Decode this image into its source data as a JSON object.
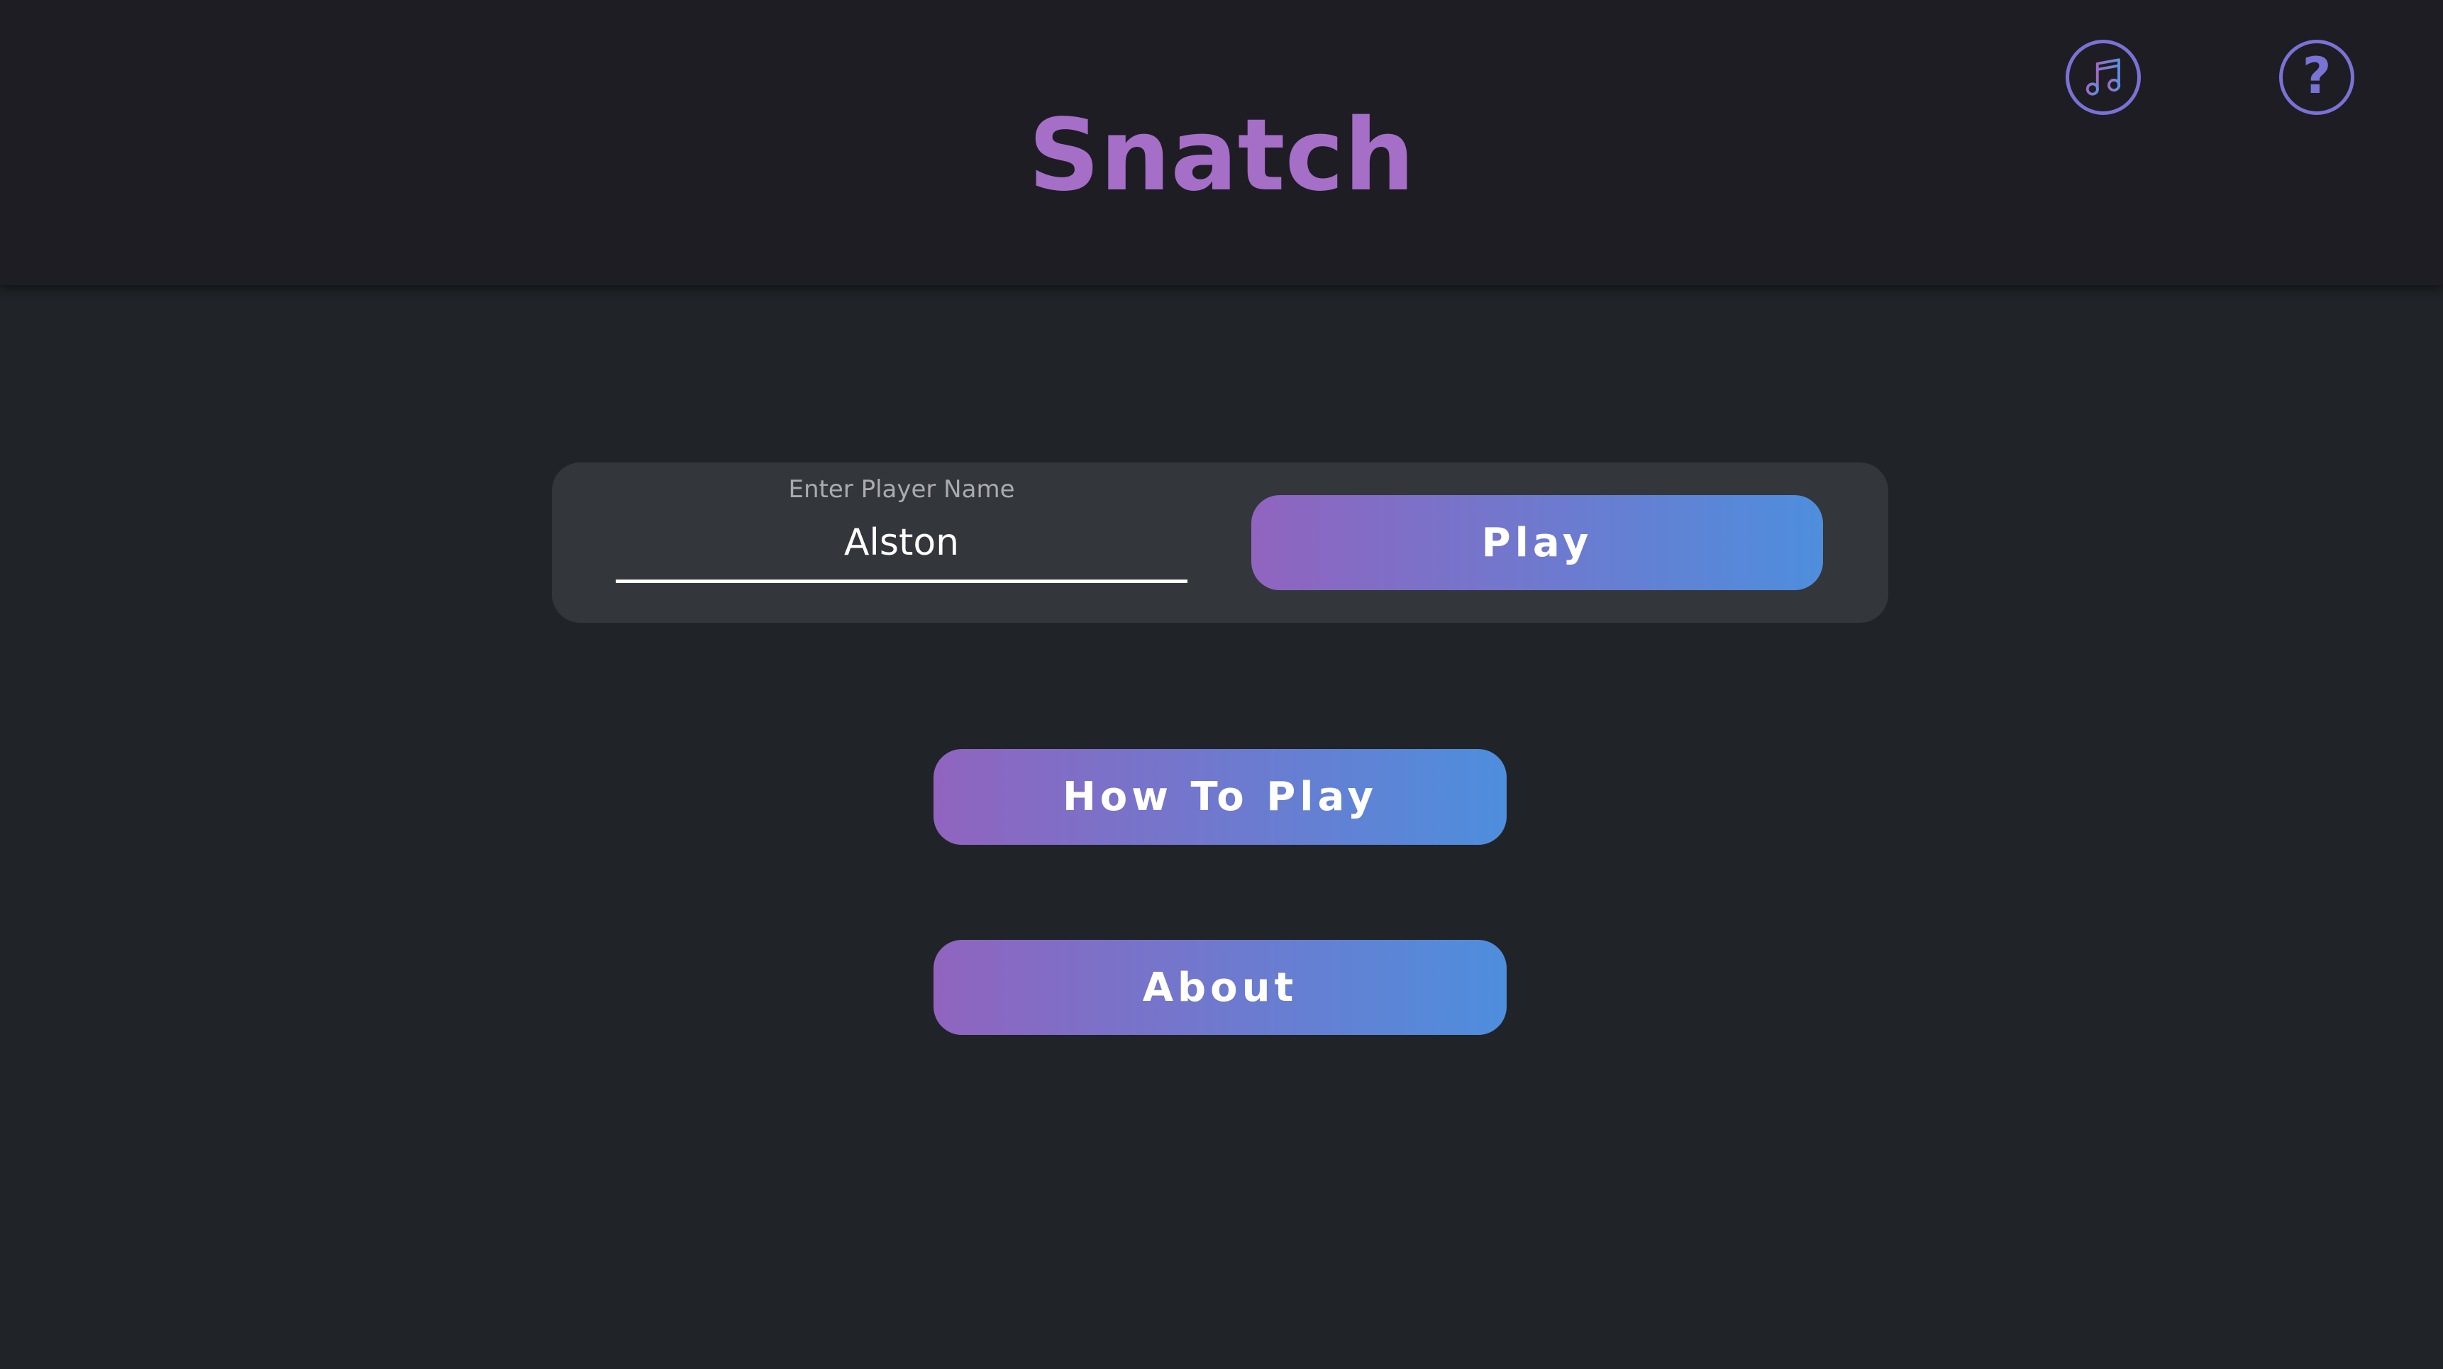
{
  "app": {
    "title": "Snatch"
  },
  "header": {
    "icons": {
      "music": "music-note-icon",
      "help": "question-mark-icon",
      "help_glyph": "?"
    }
  },
  "login": {
    "name_label": "Enter Player Name",
    "name_value": "Alston",
    "play_label": "Play"
  },
  "menu": {
    "how_to_play_label": "How To Play",
    "about_label": "About"
  },
  "colors": {
    "header_bg": "#1e1d24",
    "page_bg": "#202428",
    "panel_bg": "#33363b",
    "title": "#a56ec7",
    "gradient_start": "#9064bf",
    "gradient_end": "#4e8edd",
    "icon_ring": "#7a72d4"
  }
}
